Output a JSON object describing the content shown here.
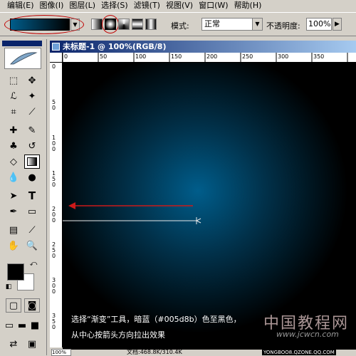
{
  "menubar": {
    "items": [
      "编辑(E)",
      "图像(I)",
      "图层(L)",
      "选择(S)",
      "滤镜(T)",
      "视图(V)",
      "窗口(W)",
      "帮助(H)"
    ]
  },
  "options": {
    "gradient_from": "#005d8b",
    "gradient_to": "#000000",
    "mode_label": "模式:",
    "mode_value": "正常",
    "opacity_label": "不透明度:",
    "opacity_value": "100%",
    "highlight_color": "#c00000"
  },
  "toolbox": {
    "foreground": "#000000",
    "background": "#ffffff"
  },
  "document": {
    "title": "未标题-1 @ 100%(RGB/8)",
    "ruler_h_labels": [
      "0",
      "50",
      "100",
      "150",
      "200",
      "250",
      "300",
      "350"
    ],
    "ruler_v_labels": [
      "0",
      "5\n0",
      "1\n0\n0",
      "1\n5\n0",
      "2\n0\n0",
      "2\n5\n0",
      "3\n0\n0",
      "3\n5\n0"
    ],
    "caption_line1": "选择“渐变”工具，暗蓝（#005d8b）色至黑色，",
    "caption_line2": "从中心按箭头方向拉出效果",
    "watermark": "中国教程网",
    "watermark_url": "www.jcwcn.com",
    "zoom": "100%",
    "doc_info": "文档:468.8K/310.4K",
    "site_url": "YONGBOO8.QZONE.QQ.COM"
  }
}
